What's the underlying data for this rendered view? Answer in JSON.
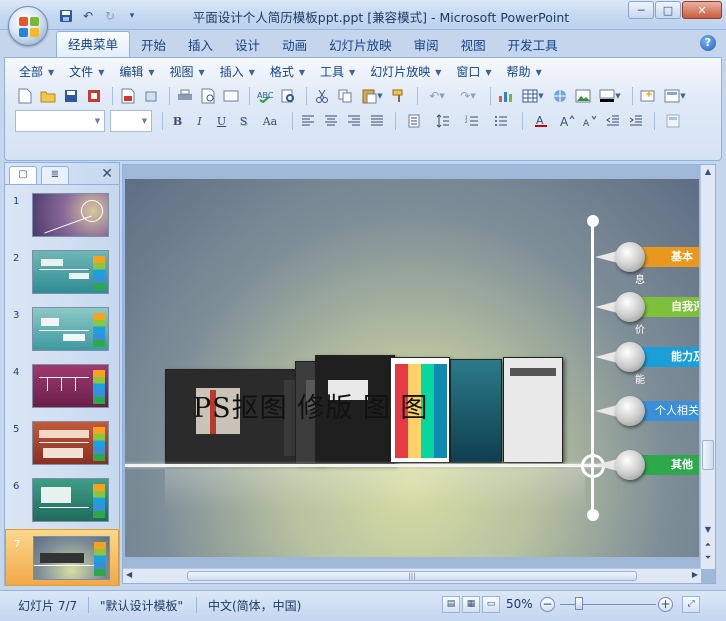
{
  "window": {
    "title": "平面设计个人简历模板ppt.ppt [兼容模式] - Microsoft PowerPoint",
    "minimize": "─",
    "maximize": "□",
    "close": "✕"
  },
  "ribbon_tabs": [
    "经典菜单",
    "开始",
    "插入",
    "设计",
    "动画",
    "幻灯片放映",
    "审阅",
    "视图",
    "开发工具"
  ],
  "classic_menu": [
    "全部",
    "文件",
    "编辑",
    "视图",
    "插入",
    "格式",
    "工具",
    "幻灯片放映",
    "窗口",
    "帮助"
  ],
  "help": "?",
  "format_buttons": [
    "B",
    "I",
    "U",
    "S",
    "Aa"
  ],
  "slides_panel": {
    "numbers": [
      "1",
      "2",
      "3",
      "4",
      "5",
      "6",
      "7"
    ],
    "selected": 7
  },
  "slide": {
    "title": "PS抠图    修版  图   图",
    "labels": [
      {
        "text": "基本",
        "sub": "息",
        "color": "#e8981f"
      },
      {
        "text": "自我评",
        "sub": "价",
        "color": "#7fc03a"
      },
      {
        "text": "能力及技",
        "sub": "能",
        "color": "#1b9fd8"
      },
      {
        "text": "个人相关经",
        "sub": "",
        "color": "#3b8fd9"
      },
      {
        "text": "其他",
        "sub": "",
        "color": "#2fa84c"
      }
    ]
  },
  "statusbar": {
    "slide_info": "幻灯片 7/7",
    "theme": "\"默认设计模板\"",
    "language": "中文(简体，中国)",
    "zoom": "50%"
  },
  "icons": [
    "office-button-icon",
    "save-icon",
    "undo-icon",
    "redo-icon",
    "new-icon",
    "open-icon",
    "print-icon",
    "cut-icon",
    "copy-icon",
    "paste-icon",
    "chart-icon",
    "table-icon"
  ]
}
